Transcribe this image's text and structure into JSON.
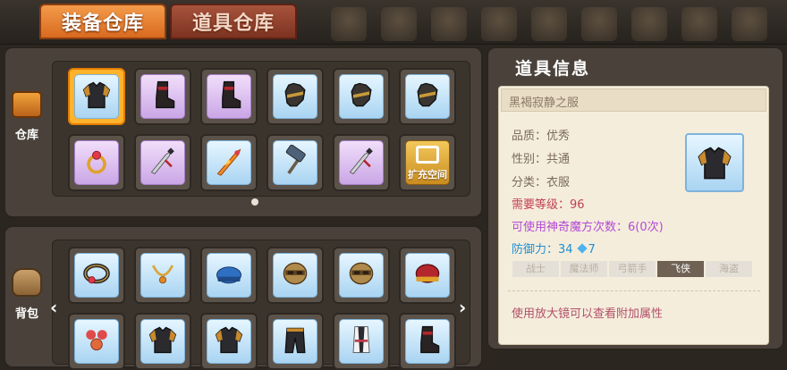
{
  "tabs": [
    {
      "label": "装备仓库",
      "active": true
    },
    {
      "label": "道具仓库",
      "active": false
    }
  ],
  "top_icons": [
    "bell-icon",
    "ladder-icon",
    "portrait-icon",
    "door-icon",
    "chair-icon",
    "tower-icon",
    "horse-icon",
    "book-icon",
    "cube-icon"
  ],
  "warehouse": {
    "label": "仓库",
    "rows": [
      [
        {
          "icon": "armor-icon",
          "bg": "blue",
          "selected": true
        },
        {
          "icon": "boots-icon",
          "bg": "purple"
        },
        {
          "icon": "boots-icon",
          "bg": "purple"
        },
        {
          "icon": "glove-icon",
          "bg": "blue"
        },
        {
          "icon": "glove-icon",
          "bg": "blue"
        },
        {
          "icon": "glove-icon",
          "bg": "blue"
        }
      ],
      [
        {
          "icon": "ring-icon",
          "bg": "purple"
        },
        {
          "icon": "dagger-icon",
          "bg": "purple"
        },
        {
          "icon": "flame-sword-icon",
          "bg": "blue"
        },
        {
          "icon": "hammer-icon",
          "bg": "blue"
        },
        {
          "icon": "dagger-icon",
          "bg": "purple"
        },
        {
          "icon": "expand-icon",
          "bg": "expand",
          "label": "扩充空间"
        }
      ]
    ]
  },
  "backpack": {
    "label": "背包",
    "rows": [
      [
        {
          "icon": "belt-icon",
          "bg": "blue"
        },
        {
          "icon": "necklace-icon",
          "bg": "blue"
        },
        {
          "icon": "cap-icon",
          "bg": "blue"
        },
        {
          "icon": "helmet-icon",
          "bg": "blue"
        },
        {
          "icon": "helmet-icon",
          "bg": "blue"
        },
        {
          "icon": "hat-icon",
          "bg": "blue"
        }
      ],
      [
        {
          "icon": "earring-icon",
          "bg": "blue"
        },
        {
          "icon": "armor-icon",
          "bg": "blue"
        },
        {
          "icon": "armor-icon",
          "bg": "blue"
        },
        {
          "icon": "pants-icon",
          "bg": "blue"
        },
        {
          "icon": "outfit-icon",
          "bg": "blue"
        },
        {
          "icon": "boots-icon",
          "bg": "blue"
        }
      ]
    ]
  },
  "info": {
    "title": "道具信息",
    "item_name": "黑褐寂静之服",
    "quality": "品质：优秀",
    "gender": "性别：共通",
    "category": "分类：衣服",
    "required_level": "需要等级：96",
    "magic_cube": "可使用神奇魔方次数：6(0次)",
    "defense": "防御力：34",
    "defense_bonus": "7",
    "classes": [
      {
        "label": "战士",
        "active": false
      },
      {
        "label": "魔法师",
        "active": false
      },
      {
        "label": "弓箭手",
        "active": false
      },
      {
        "label": "飞侠",
        "active": true
      },
      {
        "label": "海盗",
        "active": false
      }
    ],
    "hint": "使用放大镜可以查看附加属性"
  },
  "colors": {
    "accent_orange": "#f39b4a",
    "panel": "#4a423a",
    "card": "#f5eddc",
    "required": "#c0404f",
    "magic": "#b24ad6",
    "defense": "#1f8fd1"
  }
}
